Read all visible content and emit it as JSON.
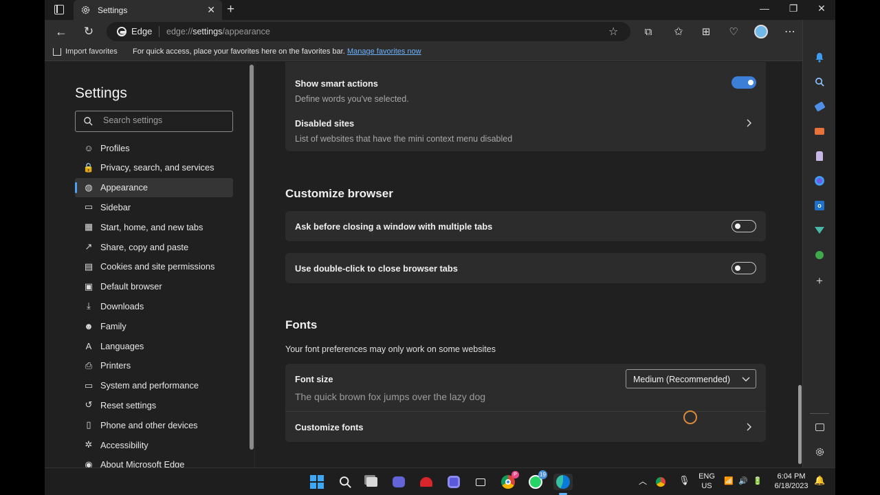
{
  "tab": {
    "title": "Settings"
  },
  "address": {
    "site_label": "Edge",
    "url_prefix": "edge://",
    "url_main": "settings",
    "url_path": "/appearance"
  },
  "favbar": {
    "import_label": "Import favorites",
    "hint": "For quick access, place your favorites here on the favorites bar.",
    "manage_link": "Manage favorites now"
  },
  "nav": {
    "heading": "Settings",
    "search_placeholder": "Search settings",
    "items": [
      {
        "label": "Profiles",
        "icon": "profile-icon"
      },
      {
        "label": "Privacy, search, and services",
        "icon": "lock-icon"
      },
      {
        "label": "Appearance",
        "icon": "palette-icon",
        "active": true
      },
      {
        "label": "Sidebar",
        "icon": "sidebar-icon"
      },
      {
        "label": "Start, home, and new tabs",
        "icon": "home-icon"
      },
      {
        "label": "Share, copy and paste",
        "icon": "share-icon"
      },
      {
        "label": "Cookies and site permissions",
        "icon": "cookie-icon"
      },
      {
        "label": "Default browser",
        "icon": "browser-icon"
      },
      {
        "label": "Downloads",
        "icon": "download-icon"
      },
      {
        "label": "Family",
        "icon": "family-icon"
      },
      {
        "label": "Languages",
        "icon": "languages-icon"
      },
      {
        "label": "Printers",
        "icon": "printer-icon"
      },
      {
        "label": "System and performance",
        "icon": "laptop-icon"
      },
      {
        "label": "Reset settings",
        "icon": "reset-icon"
      },
      {
        "label": "Phone and other devices",
        "icon": "phone-icon"
      },
      {
        "label": "Accessibility",
        "icon": "accessibility-icon"
      },
      {
        "label": "About Microsoft Edge",
        "icon": "edge-icon"
      }
    ]
  },
  "content": {
    "smart_actions": {
      "title": "Show smart actions",
      "subtitle": "Define words you've selected.",
      "enabled": true
    },
    "disabled_sites": {
      "title": "Disabled sites",
      "subtitle": "List of websites that have the mini context menu disabled"
    },
    "customize_browser": {
      "title": "Customize browser",
      "ask_before_closing": {
        "title": "Ask before closing a window with multiple tabs",
        "enabled": false
      },
      "double_click_close": {
        "title": "Use double-click to close browser tabs",
        "enabled": false
      }
    },
    "fonts": {
      "title": "Fonts",
      "subtitle": "Your font preferences may only work on some websites",
      "font_size_label": "Font size",
      "font_size_value": "Medium (Recommended)",
      "preview": "The quick brown fox jumps over the lazy dog",
      "customize_fonts": "Customize fonts"
    }
  },
  "taskbar": {
    "whatsapp_badge": "19",
    "chrome_badge": "P",
    "lang_line1": "ENG",
    "lang_line2": "US",
    "time": "6:04 PM",
    "date": "6/18/2023"
  },
  "colors": {
    "accent": "#3b7fd8",
    "link": "#6cb3ff",
    "background": "#202020",
    "card": "#2c2c2c"
  }
}
